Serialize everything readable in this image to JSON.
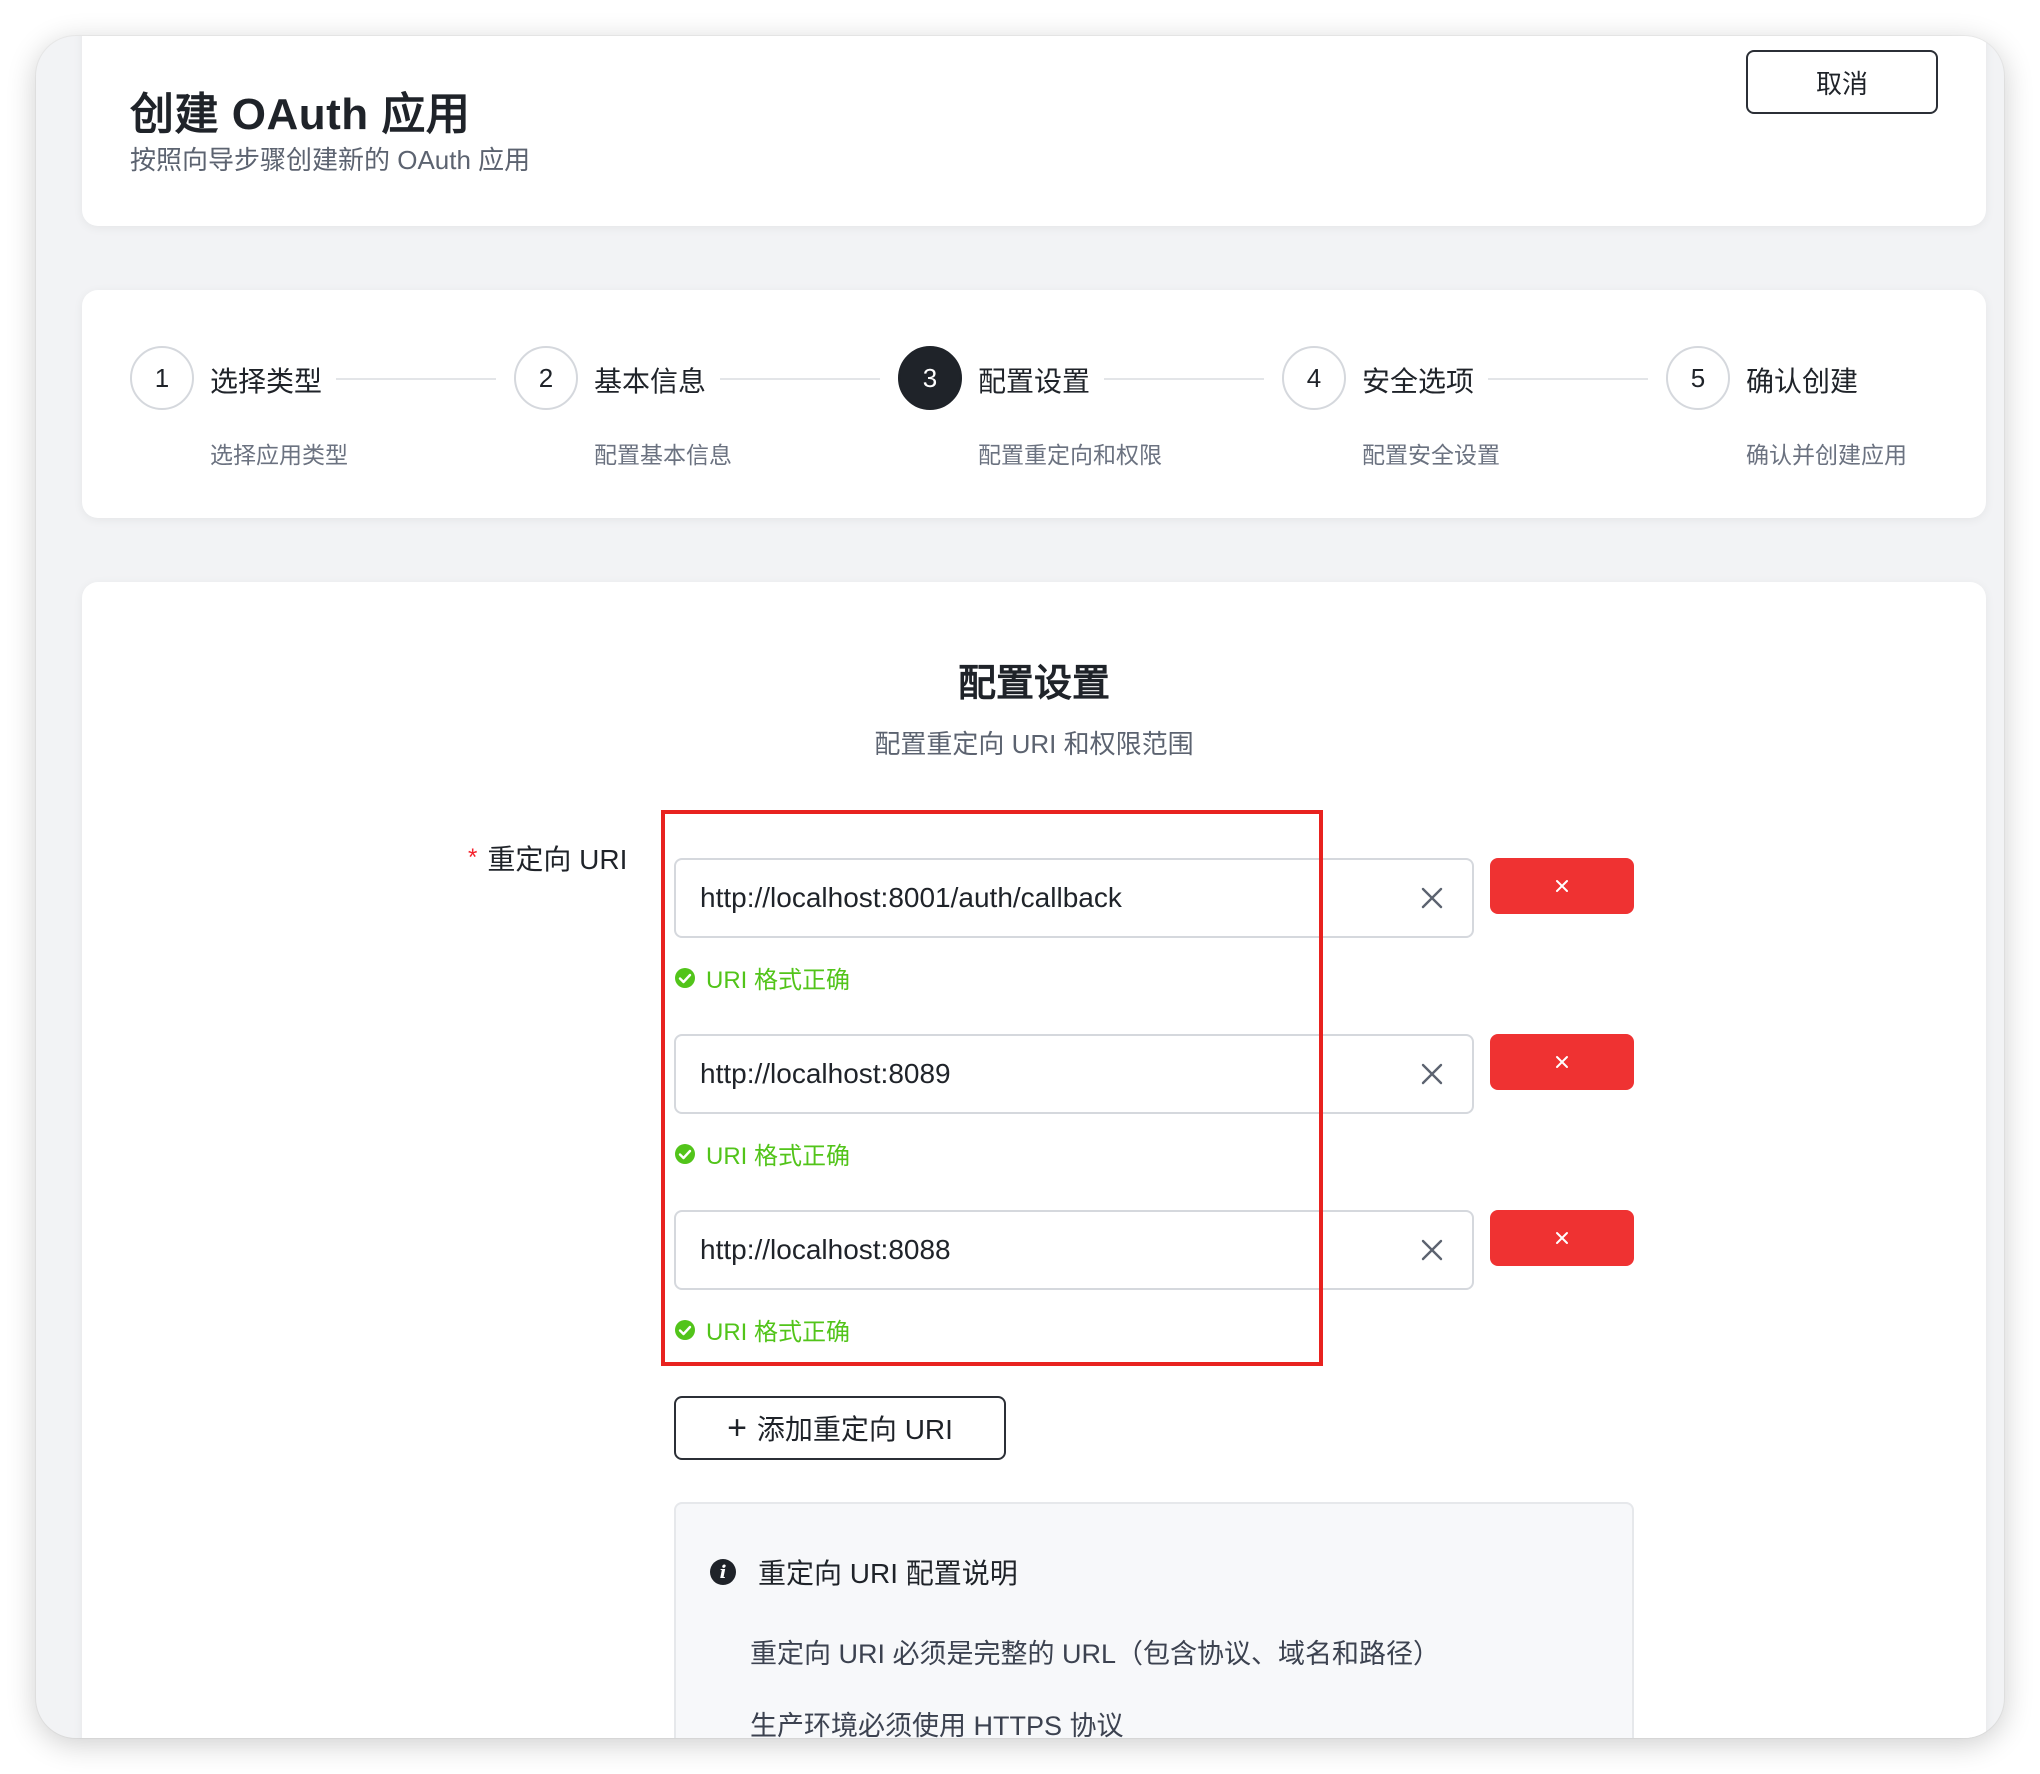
{
  "header": {
    "title": "创建 OAuth 应用",
    "subtitle": "按照向导步骤创建新的 OAuth 应用",
    "cancel_label": "取消"
  },
  "steps": [
    {
      "number": "1",
      "title": "选择类型",
      "description": "选择应用类型",
      "status": "done"
    },
    {
      "number": "2",
      "title": "基本信息",
      "description": "配置基本信息",
      "status": "done"
    },
    {
      "number": "3",
      "title": "配置设置",
      "description": "配置重定向和权限",
      "status": "active"
    },
    {
      "number": "4",
      "title": "安全选项",
      "description": "配置安全设置",
      "status": "pending"
    },
    {
      "number": "5",
      "title": "确认创建",
      "description": "确认并创建应用",
      "status": "pending"
    }
  ],
  "section": {
    "title": "配置设置",
    "subtitle": "配置重定向 URI 和权限范围"
  },
  "redirect_uri": {
    "label": "重定向 URI",
    "required": true,
    "items": [
      {
        "value": "http://localhost:8001/auth/callback",
        "status": "URI 格式正确"
      },
      {
        "value": "http://localhost:8089",
        "status": "URI 格式正确"
      },
      {
        "value": "http://localhost:8088",
        "status": "URI 格式正确"
      }
    ],
    "add_label": "添加重定向 URI"
  },
  "info": {
    "heading": "重定向 URI 配置说明",
    "lines": [
      "重定向 URI 必须是完整的 URL（包含协议、域名和路径）",
      "生产环境必须使用 HTTPS 协议"
    ]
  },
  "colors": {
    "accent": "#1f2329",
    "danger": "#ef3232",
    "success": "#52c41a",
    "highlight": "#e8221f"
  },
  "icons": {
    "clear": "close-icon",
    "delete": "close-icon",
    "valid": "check-circle-icon",
    "info": "info-icon",
    "add": "plus-icon"
  }
}
